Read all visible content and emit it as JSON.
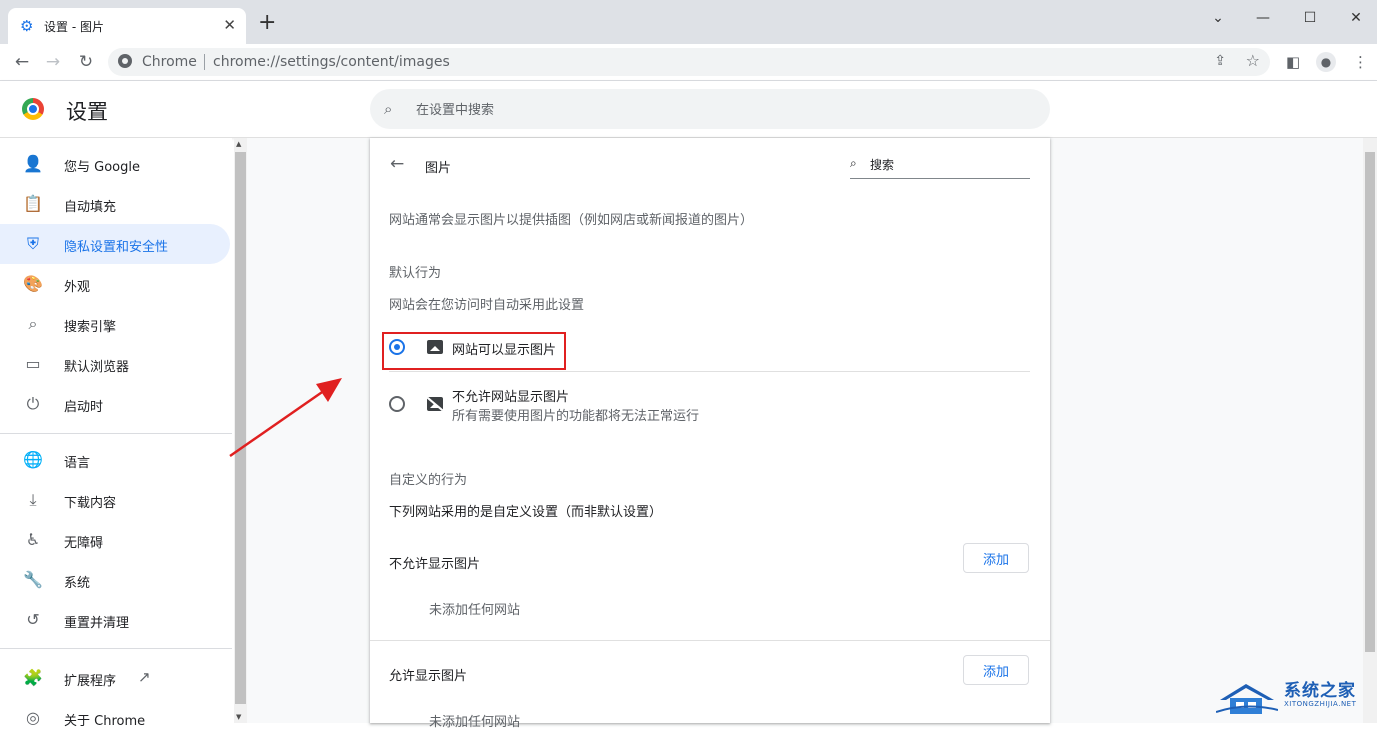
{
  "browser": {
    "tab_title": "设置 - 图片",
    "omnibox_site_label": "Chrome",
    "url": "chrome://settings/content/images"
  },
  "settings": {
    "title": "设置",
    "search_placeholder": "在设置中搜索"
  },
  "sidebar": {
    "items": [
      {
        "label": "您与 Google",
        "icon": "person-icon",
        "active": false
      },
      {
        "label": "自动填充",
        "icon": "clipboard-icon",
        "active": false
      },
      {
        "label": "隐私设置和安全性",
        "icon": "shield-icon",
        "active": true
      },
      {
        "label": "外观",
        "icon": "palette-icon",
        "active": false
      },
      {
        "label": "搜索引擎",
        "icon": "search-icon",
        "active": false
      },
      {
        "label": "默认浏览器",
        "icon": "browser-window-icon",
        "active": false
      },
      {
        "label": "启动时",
        "icon": "power-icon",
        "active": false
      },
      {
        "label": "语言",
        "icon": "globe-icon",
        "active": false
      },
      {
        "label": "下载内容",
        "icon": "download-icon",
        "active": false
      },
      {
        "label": "无障碍",
        "icon": "accessibility-icon",
        "active": false
      },
      {
        "label": "系统",
        "icon": "wrench-icon",
        "active": false
      },
      {
        "label": "重置并清理",
        "icon": "history-icon",
        "active": false
      },
      {
        "label": "扩展程序",
        "icon": "puzzle-icon",
        "active": false
      },
      {
        "label": "关于 Chrome",
        "icon": "chrome-icon",
        "active": false
      }
    ]
  },
  "page": {
    "title": "图片",
    "search_placeholder": "搜索",
    "description": "网站通常会显示图片以提供插图（例如网店或新闻报道的图片）",
    "default_behavior": {
      "heading": "默认行为",
      "subheading": "网站会在您访问时自动采用此设置",
      "options": [
        {
          "label": "网站可以显示图片",
          "sublabel": "",
          "checked": true
        },
        {
          "label": "不允许网站显示图片",
          "sublabel": "所有需要使用图片的功能都将无法正常运行",
          "checked": false
        }
      ]
    },
    "custom_behavior": {
      "heading": "自定义的行为",
      "subheading": "下列网站采用的是自定义设置（而非默认设置）",
      "blocked": {
        "label": "不允许显示图片",
        "add_label": "添加",
        "empty": "未添加任何网站"
      },
      "allowed": {
        "label": "允许显示图片",
        "add_label": "添加",
        "empty": "未添加任何网站"
      }
    }
  },
  "watermark": {
    "brand": "系统之家",
    "domain": "XITONGZHIJIA.NET"
  },
  "colors": {
    "accent": "#1a73e8",
    "highlight": "#e02020"
  }
}
